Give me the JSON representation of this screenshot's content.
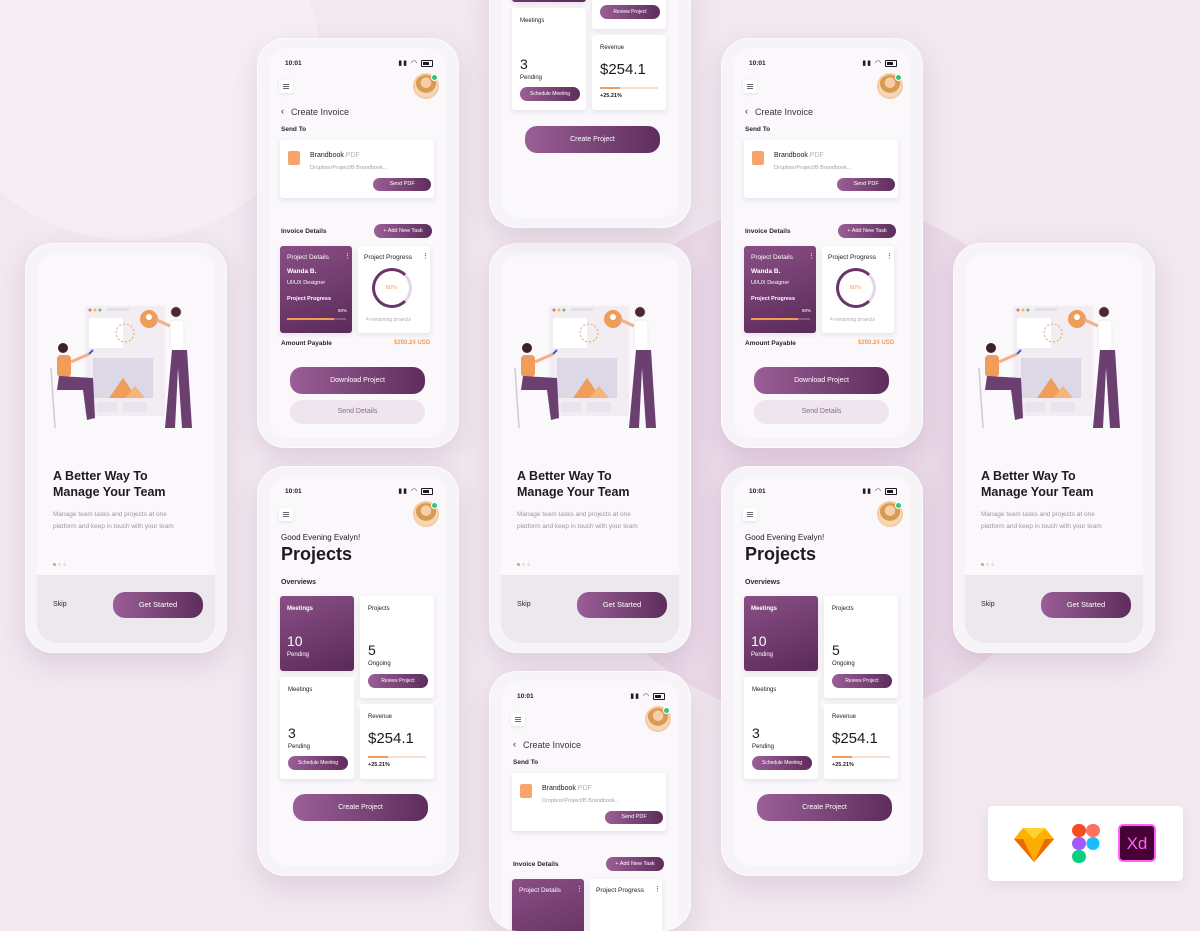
{
  "status_time": "10:01",
  "onboarding": {
    "title_line1": "A Better Way To",
    "title_line2": "Manage Your Team",
    "desc_line1": "Manage team tasks and projects at one",
    "desc_line2": "platform and keep in touch with your team",
    "skip": "Skip",
    "cta": "Get Started"
  },
  "invoice": {
    "title": "Create Invoice",
    "send_to": "Send To",
    "file_name": "Brandbook",
    "file_ext": ".PDF",
    "file_path": "Dropbox/Project/B Brandbook...",
    "send_pdf": "Send PDF",
    "invoice_details": "Invoice Details",
    "add_task": "Add New Task",
    "project_details": "Project Details",
    "person_name": "Wanda B.",
    "person_role": "UI/UX Designer",
    "project_progress_label": "Project Progress",
    "project_progress_pct": "80%",
    "progress_card_title": "Project Progress",
    "ring_pct": "80%",
    "remaining": "4 remaining projects",
    "amount_label": "Amount Payable",
    "amount_value": "$250.24 USD",
    "download": "Download Project",
    "send_details": "Send Details"
  },
  "projects": {
    "greeting": "Good Evening Evalyn!",
    "title": "Projects",
    "overviews": "Overviews",
    "meetings_card1_label": "Meetings",
    "meetings_card1_num": "10",
    "meetings_card1_sub": "Pending",
    "projects_label": "Projects",
    "projects_num": "5",
    "projects_sub": "Ongoing",
    "review": "Review Project",
    "meetings_label": "Meetings",
    "meetings_num": "3",
    "meetings_sub": "Pending",
    "schedule": "Schedule Meeting",
    "revenue_label": "Revenue",
    "revenue_value": "$254.1",
    "revenue_change": "+25.21%",
    "create": "Create Project"
  },
  "tools": [
    "sketch-icon",
    "figma-icon",
    "xd-icon"
  ],
  "xd_label": "Xd",
  "colors": {
    "accent": "#6a3468",
    "orange": "#f09d5a",
    "bg": "#f1e8f0"
  }
}
